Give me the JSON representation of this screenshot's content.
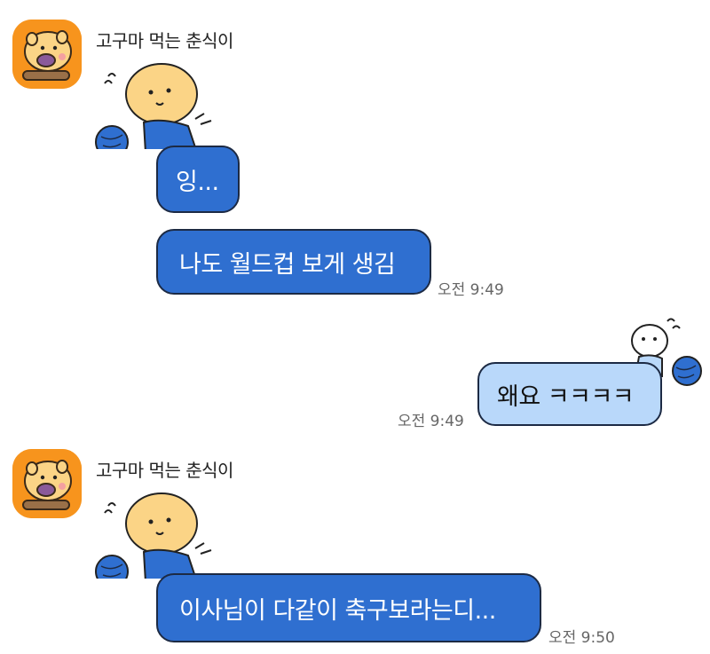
{
  "chat": {
    "groups": [
      {
        "sender": "고구마 먹는 춘식이",
        "messages": [
          "잉...",
          "나도 월드컵 보게 생김"
        ],
        "time": "오전 9:49"
      },
      {
        "sender": "me",
        "messages": [
          "왜요 ㅋㅋㅋㅋ"
        ],
        "time": "오전 9:49"
      },
      {
        "sender": "고구마 먹는 춘식이",
        "messages": [
          "이사님이 다같이 축구보라는디..."
        ],
        "time": "오전 9:50"
      }
    ]
  },
  "colors": {
    "incoming_bubble": "#2f6fd0",
    "outgoing_bubble": "#b9d8fa",
    "avatar_bg": "#f7941d",
    "yarn": "#2f6fd0"
  },
  "icons": {
    "avatar": "choonsik-sweet-potato-avatar",
    "sticker_in": "choonsik-knitting-sticker",
    "sticker_out": "white-bear-knitting-sticker"
  }
}
